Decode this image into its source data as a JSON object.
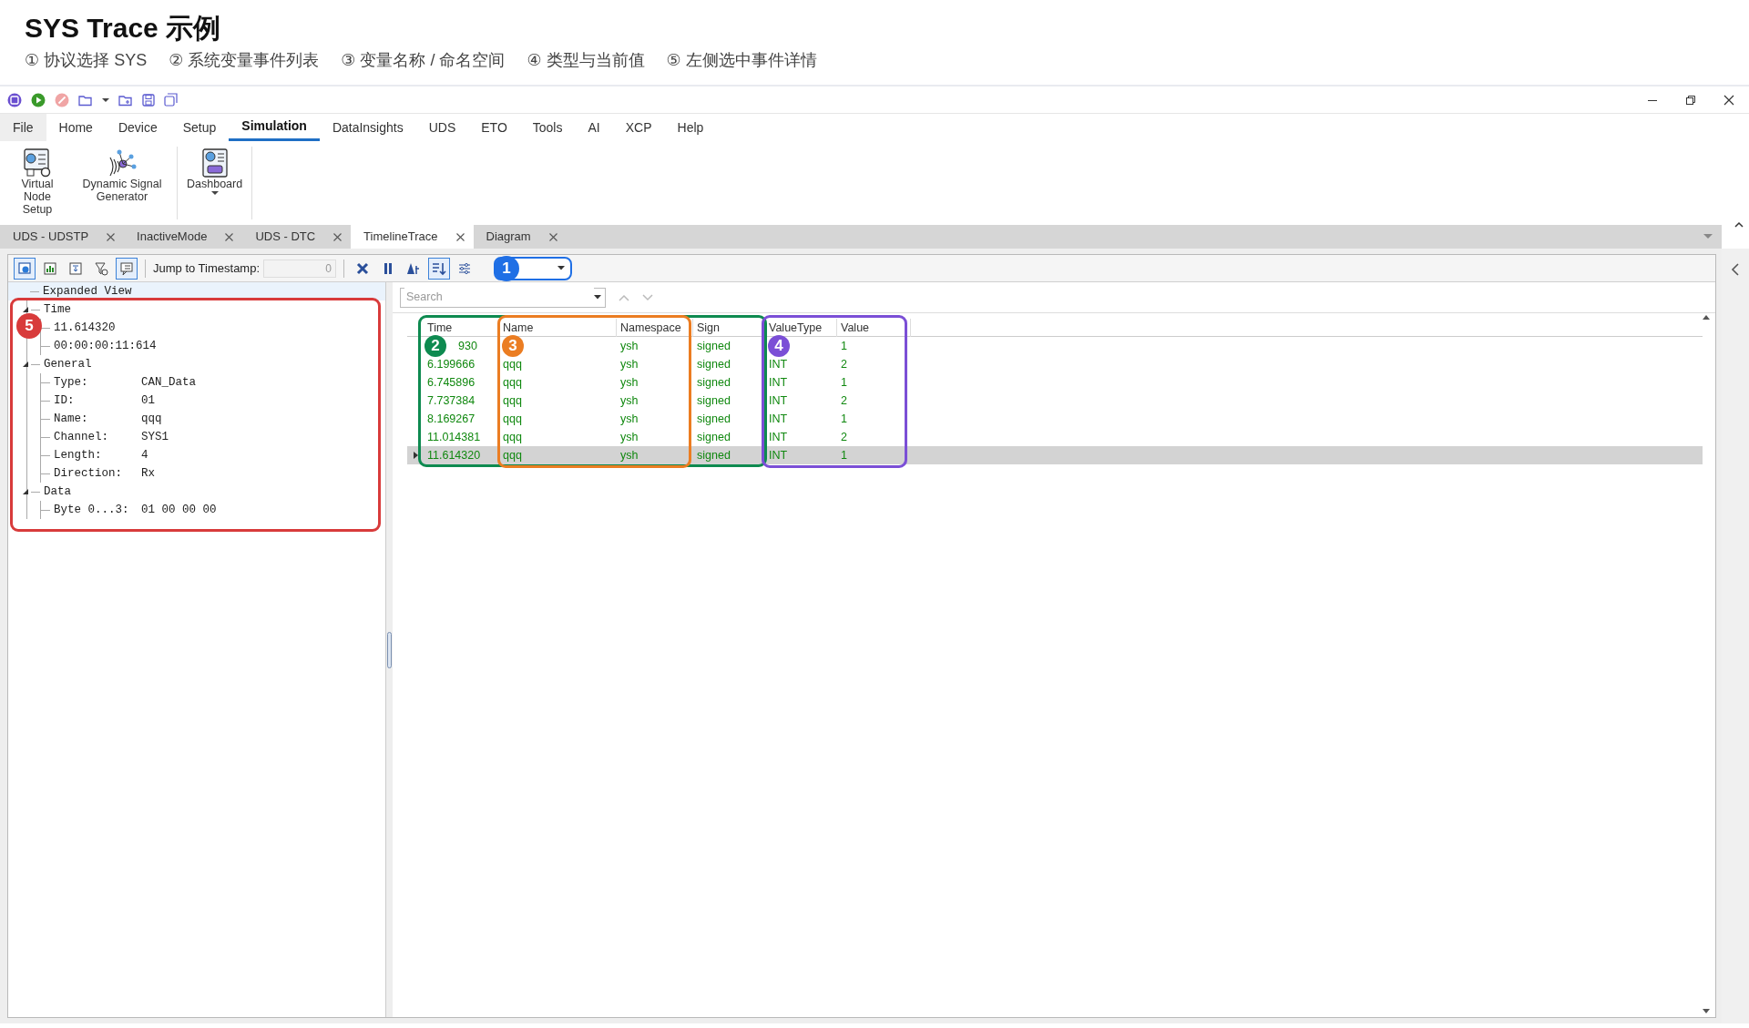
{
  "heading": {
    "title": "SYS Trace 示例",
    "steps": [
      "① 协议选择 SYS",
      "② 系统变量事件列表",
      "③ 变量名称 / 命名空间",
      "④ 类型与当前值",
      "⑤ 左侧选中事件详情"
    ]
  },
  "menu": [
    {
      "label": "File",
      "kind": "file",
      "selected": false
    },
    {
      "label": "Home",
      "kind": "tab",
      "selected": false
    },
    {
      "label": "Device",
      "kind": "tab",
      "selected": false
    },
    {
      "label": "Setup",
      "kind": "tab",
      "selected": false
    },
    {
      "label": "Simulation",
      "kind": "tab",
      "selected": true
    },
    {
      "label": "DataInsights",
      "kind": "tab",
      "selected": false
    },
    {
      "label": "UDS",
      "kind": "tab",
      "selected": false
    },
    {
      "label": "ETO",
      "kind": "tab",
      "selected": false
    },
    {
      "label": "Tools",
      "kind": "tab",
      "selected": false
    },
    {
      "label": "AI",
      "kind": "tab",
      "selected": false
    },
    {
      "label": "XCP",
      "kind": "tab",
      "selected": false
    },
    {
      "label": "Help",
      "kind": "tab",
      "selected": false
    }
  ],
  "ribbon": [
    {
      "label": "Virtual Node Setup",
      "kind": "node",
      "dropdown": false
    },
    {
      "label": "Dynamic Signal Generator",
      "kind": "signal",
      "dropdown": false
    },
    {
      "label": "Dashboard",
      "kind": "dashboard",
      "dropdown": true
    }
  ],
  "doc_tabs": [
    {
      "label": "UDS - UDSTP",
      "selected": false
    },
    {
      "label": "InactiveMode",
      "selected": false
    },
    {
      "label": "UDS - DTC",
      "selected": false
    },
    {
      "label": "TimelineTrace",
      "selected": true
    },
    {
      "label": "Diagram",
      "selected": false
    }
  ],
  "toolbar": {
    "left": [
      {
        "kind": "view",
        "pressed": true
      },
      {
        "kind": "chart",
        "pressed": false
      },
      {
        "kind": "export",
        "pressed": false
      },
      {
        "kind": "filter",
        "pressed": false
      },
      {
        "kind": "comment",
        "pressed": true
      }
    ],
    "jump_label": "Jump to Timestamp:",
    "jump_value": "0",
    "right": [
      {
        "kind": "clear",
        "pressed": false
      },
      {
        "kind": "pause",
        "pressed": false
      },
      {
        "kind": "font",
        "pressed": false
      },
      {
        "kind": "autoscroll",
        "pressed": true
      },
      {
        "kind": "options",
        "pressed": false
      }
    ]
  },
  "tree": {
    "root": "Expanded View",
    "children": [
      {
        "label": "Time",
        "expanded": true,
        "children": [
          {
            "label": "11.614320"
          },
          {
            "label": "00:00:00:11:614"
          }
        ]
      },
      {
        "label": "General",
        "expanded": true,
        "children": [
          {
            "label": "Type:",
            "value": "CAN_Data"
          },
          {
            "label": "ID:",
            "value": "01"
          },
          {
            "label": "Name:",
            "value": "qqq"
          },
          {
            "label": "Channel:",
            "value": "SYS1"
          },
          {
            "label": "Length:",
            "value": "4"
          },
          {
            "label": "Direction:",
            "value": "Rx"
          }
        ]
      },
      {
        "label": "Data",
        "expanded": true,
        "children": [
          {
            "label": "Byte 0...3:",
            "value": "01 00 00 00"
          }
        ]
      }
    ]
  },
  "search": {
    "placeholder": "Search"
  },
  "table": {
    "columns": [
      "Time",
      "Name",
      "Namespace",
      "Sign",
      "ValueType",
      "Value"
    ],
    "rows": [
      {
        "selected": false,
        "cells": {
          "time": "930",
          "namespace": "ysh",
          "sign": "signed",
          "value": "1"
        }
      },
      {
        "selected": false,
        "cells": {
          "time": "6.199666",
          "name": "qqq",
          "namespace": "ysh",
          "sign": "signed",
          "value_type": "INT",
          "value": "2"
        }
      },
      {
        "selected": false,
        "cells": {
          "time": "6.745896",
          "name": "qqq",
          "namespace": "ysh",
          "sign": "signed",
          "value_type": "INT",
          "value": "1"
        }
      },
      {
        "selected": false,
        "cells": {
          "time": "7.737384",
          "name": "qqq",
          "namespace": "ysh",
          "sign": "signed",
          "value_type": "INT",
          "value": "2"
        }
      },
      {
        "selected": false,
        "cells": {
          "time": "8.169267",
          "name": "qqq",
          "namespace": "ysh",
          "sign": "signed",
          "value_type": "INT",
          "value": "1"
        }
      },
      {
        "selected": false,
        "cells": {
          "time": "11.014381",
          "name": "qqq",
          "namespace": "ysh",
          "sign": "signed",
          "value_type": "INT",
          "value": "2"
        }
      },
      {
        "selected": true,
        "cells": {
          "time": "11.614320",
          "name": "qqq",
          "namespace": "ysh",
          "sign": "signed",
          "value_type": "INT",
          "value": "1"
        }
      }
    ]
  },
  "annotations": [
    {
      "number": "1",
      "color": "#1f6fe5"
    },
    {
      "number": "2",
      "color": "#0e8a50"
    },
    {
      "number": "3",
      "color": "#eb7d22"
    },
    {
      "number": "4",
      "color": "#7b4fd6"
    },
    {
      "number": "5",
      "color": "#d83b3b"
    }
  ]
}
